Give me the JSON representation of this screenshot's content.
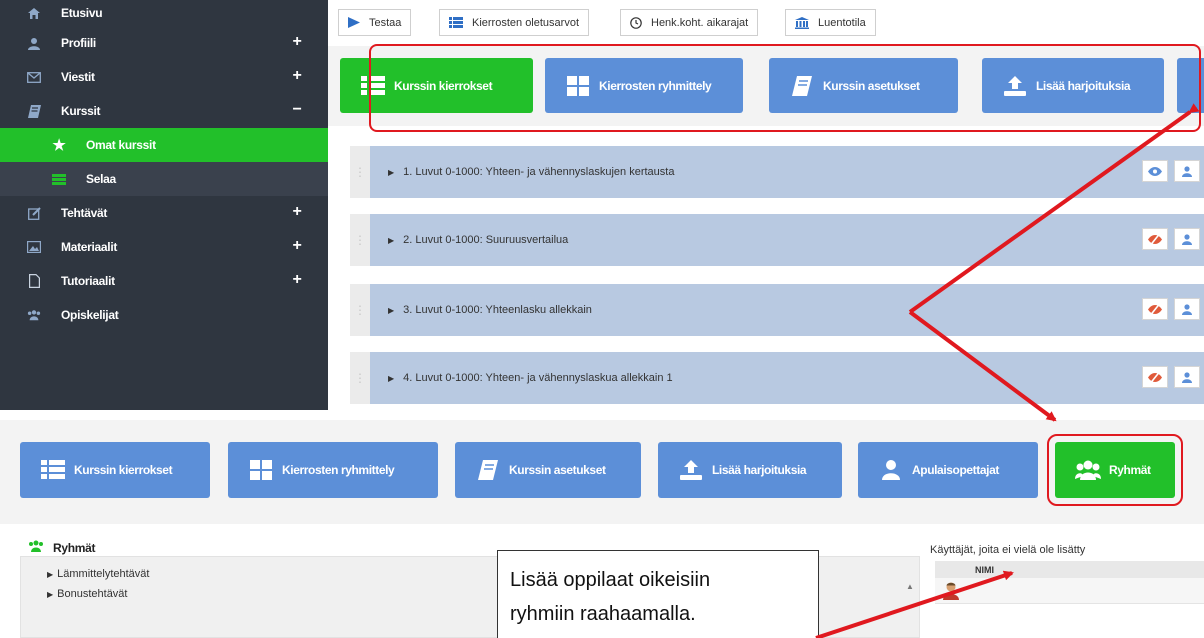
{
  "sidebar": {
    "items": [
      {
        "label": "Etusivu",
        "icon": "home-icon",
        "sign": ""
      },
      {
        "label": "Profiili",
        "icon": "user-icon",
        "sign": "+"
      },
      {
        "label": "Viestit",
        "icon": "envelope-icon",
        "sign": "+"
      },
      {
        "label": "Kurssit",
        "icon": "book-icon",
        "sign": "−"
      },
      {
        "label": "Omat kurssit",
        "icon": "star-icon",
        "sign": ""
      },
      {
        "label": "Selaa",
        "icon": "list-icon",
        "sign": ""
      },
      {
        "label": "Tehtävät",
        "icon": "edit-icon",
        "sign": "+"
      },
      {
        "label": "Materiaalit",
        "icon": "image-icon",
        "sign": "+"
      },
      {
        "label": "Tutoriaalit",
        "icon": "file-icon",
        "sign": "+"
      },
      {
        "label": "Opiskelijat",
        "icon": "users-icon",
        "sign": ""
      }
    ]
  },
  "toolbar": {
    "testaa": "Testaa",
    "oletusarvot": "Kierrosten oletusarvot",
    "aikarajat": "Henk.koht. aikarajat",
    "luentotila": "Luentotila"
  },
  "tabs": {
    "kierrokset": "Kurssin kierrokset",
    "ryhmittely": "Kierrosten ryhmittely",
    "asetukset": "Kurssin asetukset",
    "harjoituksia": "Lisää harjoituksia",
    "apulaisopettajat": "Apulaisopettajat",
    "ryhmat": "Ryhmät"
  },
  "rounds": [
    {
      "title": "1. Luvut 0-1000: Yhteen- ja vähennyslaskujen kertausta",
      "visible": true
    },
    {
      "title": "2. Luvut 0-1000: Suuruusvertailua",
      "visible": false
    },
    {
      "title": "3. Luvut 0-1000: Yhteenlasku allekkain",
      "visible": false
    },
    {
      "title": "4. Luvut 0-1000: Yhteen- ja vähennyslaskua allekkain 1",
      "visible": false
    }
  ],
  "groups": {
    "title": "Ryhmät",
    "items": [
      "Lämmittelytehtävät",
      "Bonustehtävät"
    ],
    "callout_line1": "Lisää oppilaat oikeisiin",
    "callout_line2": "ryhmiin raahaamalla.",
    "users_title": "Käyttäjät, joita ei vielä ole lisätty",
    "users_column": "NIMI"
  },
  "colors": {
    "sidebar_bg": "#2f3640",
    "active_green": "#22c02a",
    "tab_blue": "#5c8fd8",
    "round_bar": "#b8c9e1",
    "annotation_red": "#e0191f"
  }
}
